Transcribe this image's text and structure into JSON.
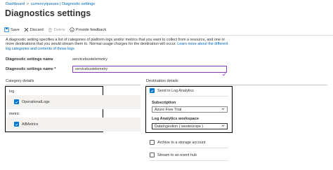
{
  "breadcrumb": {
    "items": [
      "Dashboard",
      "currencyqueues | Diagnostic settings"
    ]
  },
  "page": {
    "title": "Diagnostics settings"
  },
  "toolbar": {
    "save_label": "Save",
    "discard_label": "Discard",
    "delete_label": "Delete",
    "feedback_label": "Provide feedback"
  },
  "description": {
    "text": "A diagnostic setting specifies a list of categories of platform logs and/or metrics that you want to collect from a resource, and one or more destinations that you would stream them to. Normal usage charges for the destination will occur.",
    "link": "Learn more about the different log categories and contents of those logs"
  },
  "form": {
    "settings_name_label": "Diagnostic settings name",
    "settings_name_value": "servicebustelemetry",
    "settings_name_row2_label": "Diagnostic settings name *",
    "settings_name_input": "servicebustelemetry"
  },
  "category": {
    "header": "Category details",
    "log_label": "log",
    "log_items": [
      {
        "label": "OperationalLogs",
        "checked": true
      }
    ],
    "metric_label": "metric",
    "metric_items": [
      {
        "label": "AllMetrics",
        "checked": true
      }
    ]
  },
  "destination": {
    "header": "Destination details",
    "log_analytics_label": "Send to Log Analytics",
    "subscription_label": "Subscription",
    "subscription_value": "Azure Free Trial",
    "workspace_label": "Log Analytics workspace",
    "workspace_value": "DataIngestion ( westeurope )",
    "archive_label": "Archive to a storage account",
    "event_hub_label": "Stream to an event hub"
  },
  "colors": {
    "accent": "#0078d4",
    "link": "#0067b8",
    "selected_input_border": "#8a3ab9"
  }
}
